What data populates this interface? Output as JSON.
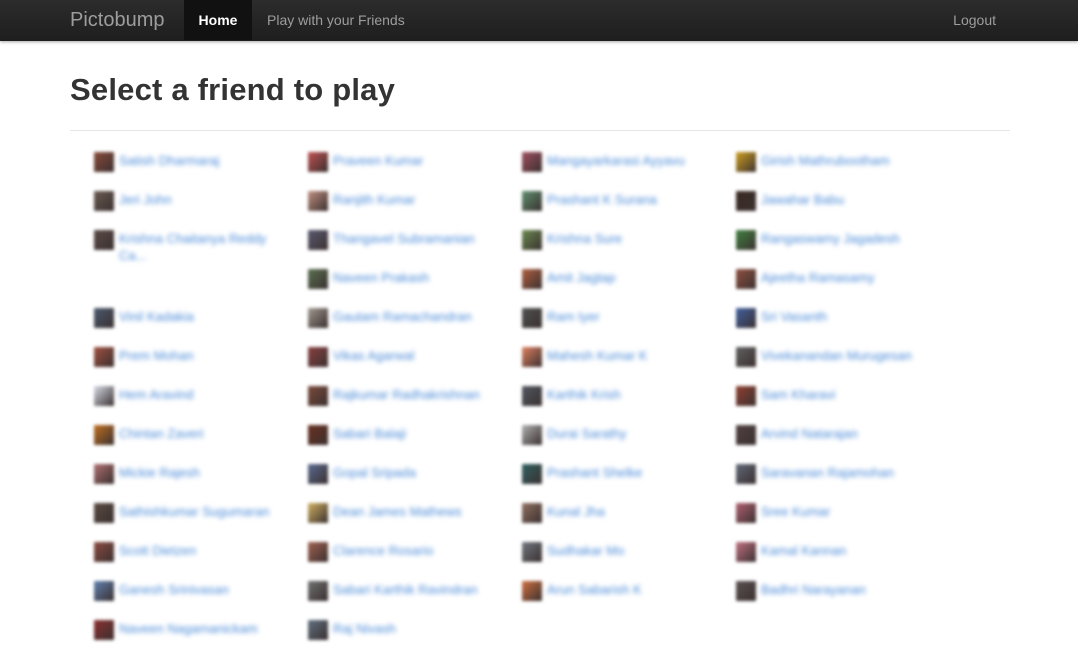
{
  "navbar": {
    "brand": "Pictobump",
    "home": "Home",
    "play": "Play with your Friends",
    "logout": "Logout"
  },
  "page": {
    "title": "Select a friend to play"
  },
  "friends": {
    "columns": [
      [
        {
          "name": "Satish Dharmaraj",
          "color": "#8a4a3a"
        },
        {
          "name": "Jeri John",
          "color": "#6a5a50"
        },
        {
          "name": "Krishna Chaitanya Reddy Ca...",
          "color": "#5a4a46"
        },
        null,
        {
          "name": "Vinil Kadakia",
          "color": "#4a5a70"
        },
        {
          "name": "Prem Mohan",
          "color": "#a05040"
        },
        {
          "name": "Hem Aravind",
          "color": "#d8dde8"
        },
        {
          "name": "Chintan Zaveri",
          "color": "#c07020"
        },
        {
          "name": "Mickie Rajesh",
          "color": "#b07070"
        },
        {
          "name": "Sathishkumar Sugumaran",
          "color": "#5a4a40"
        },
        {
          "name": "Scott Dietzen",
          "color": "#8a4a40"
        },
        {
          "name": "Ganesh Srinivasan",
          "color": "#6080b0"
        },
        {
          "name": "Naveen Nagamanickam",
          "color": "#8a3030"
        }
      ],
      [
        {
          "name": "Praveen Kumar",
          "color": "#c05050"
        },
        {
          "name": "Ranjith Kumar",
          "color": "#c09080"
        },
        {
          "name": "Thangavel Subramanian",
          "color": "#5a5a70"
        },
        {
          "name": "Naveen Prakash",
          "color": "#5a7050"
        },
        {
          "name": "Gautam Ramachandran",
          "color": "#a09890"
        },
        {
          "name": "Vikas Agarwal",
          "color": "#8a4040"
        },
        {
          "name": "Rajkumar Radhakrishnan",
          "color": "#7a4a3a"
        },
        {
          "name": "Sabari Balaji",
          "color": "#6a3020"
        },
        {
          "name": "Gopal Sripada",
          "color": "#5a6a90"
        },
        {
          "name": "Dean James Mathews",
          "color": "#d0b060"
        },
        {
          "name": "Clarence Rosario",
          "color": "#a06050"
        },
        {
          "name": "Sabari Karthik Ravindran",
          "color": "#707070"
        },
        {
          "name": "Raj Nivash",
          "color": "#607080"
        }
      ],
      [
        {
          "name": "Mangayarkarasi Ayyavu",
          "color": "#a05060"
        },
        {
          "name": "Prashant K Surana",
          "color": "#609070"
        },
        {
          "name": "Krishna Sure",
          "color": "#6a8a50"
        },
        {
          "name": "Amit Jagtap",
          "color": "#b06040"
        },
        {
          "name": "Ram Iyer",
          "color": "#505050"
        },
        {
          "name": "Mahesh Kumar K",
          "color": "#e08060"
        },
        {
          "name": "Karthik Krish",
          "color": "#505860"
        },
        {
          "name": "Durai Sarathy",
          "color": "#b0b0b0"
        },
        {
          "name": "Prashant Shelke",
          "color": "#306060"
        },
        {
          "name": "Kunal Jha",
          "color": "#907060"
        },
        {
          "name": "Sudhakar Mo",
          "color": "#707880"
        },
        {
          "name": "Arun Sabarish K",
          "color": "#d07040"
        }
      ],
      [
        {
          "name": "Girish Mathrubootham",
          "color": "#d0a020"
        },
        {
          "name": "Jawahar Babu",
          "color": "#3a2a20"
        },
        {
          "name": "Rangaswamy Jagadesh",
          "color": "#408040"
        },
        {
          "name": "Ajeetha Ramasamy",
          "color": "#905040"
        },
        {
          "name": "Sri Vasanth",
          "color": "#4060a0"
        },
        {
          "name": "Vivekanandan Murugesan",
          "color": "#606060"
        },
        {
          "name": "Sam Kharavi",
          "color": "#904030"
        },
        {
          "name": "Arvind Natarajan",
          "color": "#504040"
        },
        {
          "name": "Saravanan Rajamohan",
          "color": "#606878"
        },
        {
          "name": "Sree Kumar",
          "color": "#b06070"
        },
        {
          "name": "Kamal Kannan",
          "color": "#c07080"
        },
        {
          "name": "Badhri Narayanan",
          "color": "#5a5050"
        }
      ]
    ]
  }
}
